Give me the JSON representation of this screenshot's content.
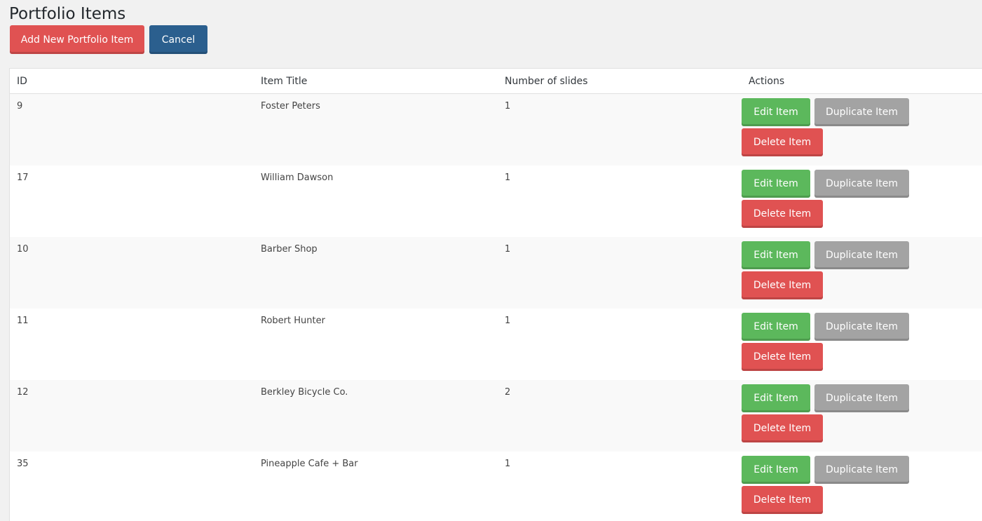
{
  "header": {
    "title": "Portfolio Items",
    "add_label": "Add New Portfolio Item",
    "cancel_label": "Cancel"
  },
  "table": {
    "columns": [
      "ID",
      "Item Title",
      "Number of slides",
      "Actions"
    ],
    "rows": [
      {
        "id": "9",
        "title": "Foster Peters",
        "slides": "1"
      },
      {
        "id": "17",
        "title": "William Dawson",
        "slides": "1"
      },
      {
        "id": "10",
        "title": "Barber Shop",
        "slides": "1"
      },
      {
        "id": "11",
        "title": "Robert Hunter",
        "slides": "1"
      },
      {
        "id": "12",
        "title": "Berkley Bicycle Co.",
        "slides": "2"
      },
      {
        "id": "35",
        "title": "Pineapple Cafe + Bar",
        "slides": "1"
      }
    ],
    "actions": {
      "edit_label": "Edit Item",
      "duplicate_label": "Duplicate Item",
      "delete_label": "Delete Item"
    }
  },
  "colors": {
    "red": "#e05252",
    "blue": "#2b5f8e",
    "green": "#5cb85c",
    "gray": "#a3a3a3"
  }
}
